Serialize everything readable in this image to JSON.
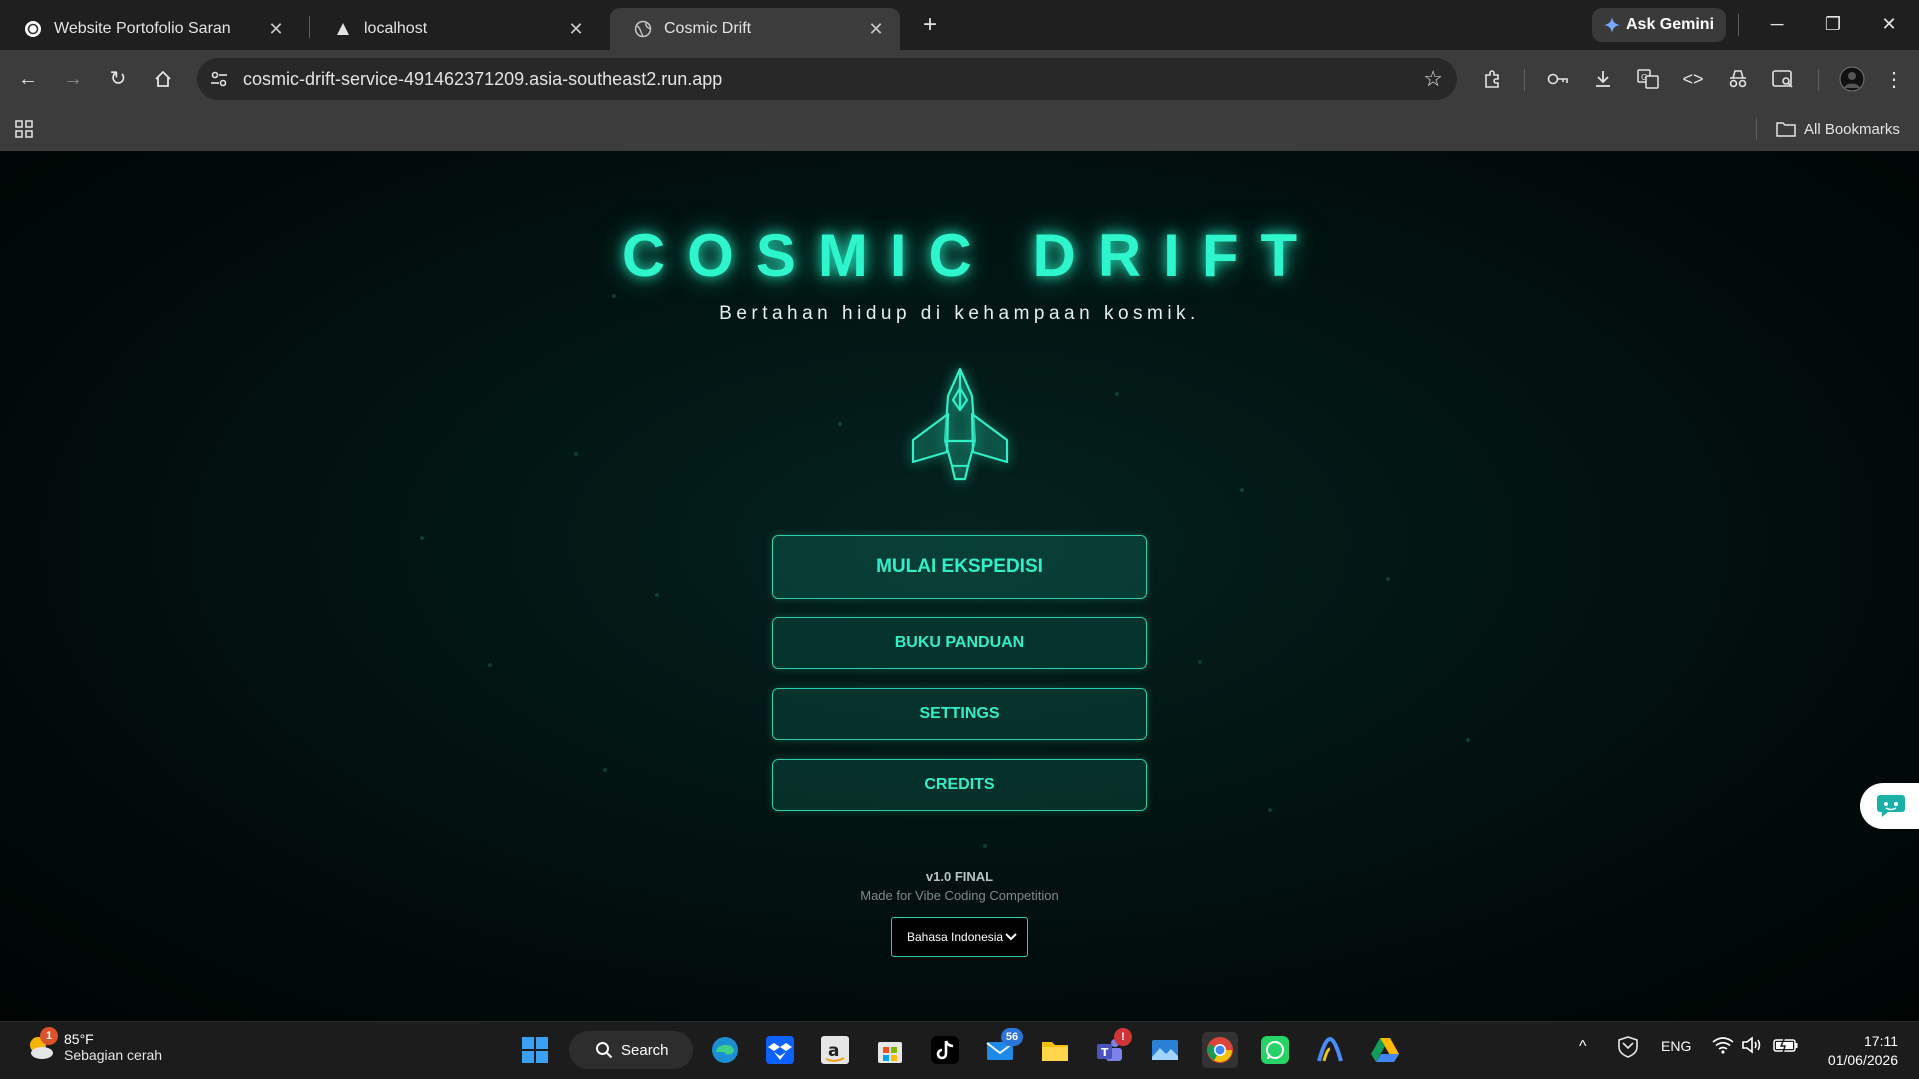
{
  "browser": {
    "tabs": [
      {
        "title": "Website Portofolio Saran",
        "active": false
      },
      {
        "title": "localhost",
        "active": false
      },
      {
        "title": "Cosmic Drift",
        "active": true
      }
    ],
    "ask_gemini": "Ask Gemini",
    "url": "cosmic-drift-service-491462371209.asia-southeast2.run.app",
    "bookmarks_label": "All Bookmarks"
  },
  "game": {
    "title": "COSMIC DRIFT",
    "subtitle": "Bertahan hidup di kehampaan kosmik.",
    "menu": {
      "start": "MULAI EKSPEDISI",
      "guide": "BUKU PANDUAN",
      "settings": "SETTINGS",
      "credits": "CREDITS"
    },
    "version": "v1.0 FINAL",
    "made_for": "Made for Vibe Coding Competition",
    "language_selected": "Bahasa Indonesia"
  },
  "taskbar": {
    "weather_temp": "85°F",
    "weather_cond": "Sebagian cerah",
    "weather_badge": "1",
    "search_label": "Search",
    "mail_badge": "56",
    "teams_badge": "!",
    "language": "ENG",
    "time": "17:11",
    "date": "01/06/2026"
  },
  "colors": {
    "accent": "#2ff5cc",
    "button_border": "#2acfae",
    "page_bg": "#021512"
  }
}
